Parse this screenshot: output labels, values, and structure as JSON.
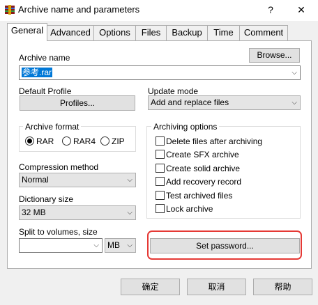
{
  "window": {
    "title": "Archive name and parameters",
    "help_glyph": "?",
    "close_glyph": "✕",
    "icon": "winrar-archive-icon"
  },
  "tabs": [
    {
      "label": "General",
      "active": true
    },
    {
      "label": "Advanced"
    },
    {
      "label": "Options"
    },
    {
      "label": "Files"
    },
    {
      "label": "Backup"
    },
    {
      "label": "Time"
    },
    {
      "label": "Comment"
    }
  ],
  "archive": {
    "name_label": "Archive name",
    "browse_label": "Browse...",
    "name_value": "参考.rar"
  },
  "profile": {
    "label": "Default Profile",
    "button": "Profiles..."
  },
  "update_mode": {
    "label": "Update mode",
    "value": "Add and replace files"
  },
  "archive_format": {
    "label": "Archive format",
    "options": [
      "RAR",
      "RAR4",
      "ZIP"
    ],
    "selected": "RAR"
  },
  "compression": {
    "label": "Compression method",
    "value": "Normal"
  },
  "dictionary": {
    "label": "Dictionary size",
    "value": "32 MB"
  },
  "split": {
    "label": "Split to volumes, size",
    "value": "",
    "unit": "MB"
  },
  "archiving_options": {
    "label": "Archiving options",
    "items": [
      "Delete files after archiving",
      "Create SFX archive",
      "Create solid archive",
      "Add recovery record",
      "Test archived files",
      "Lock archive"
    ]
  },
  "password_button": "Set password...",
  "footer": {
    "ok": "确定",
    "cancel": "取消",
    "help": "帮助"
  },
  "colors": {
    "accent": "#0078d7",
    "highlight": "#e53935"
  }
}
